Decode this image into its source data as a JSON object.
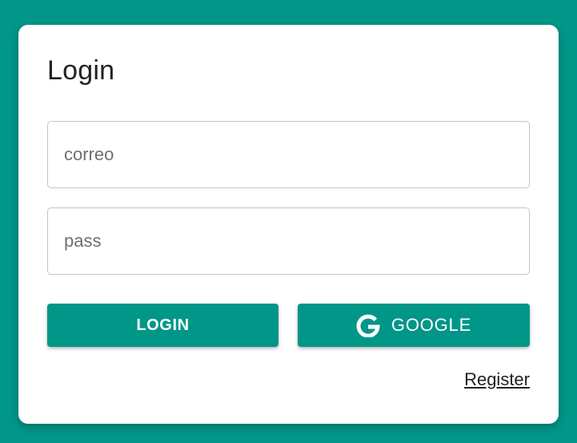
{
  "colors": {
    "background": "#009688",
    "card": "#ffffff",
    "button": "#009688",
    "button_text": "#ffffff"
  },
  "login_card": {
    "title": "Login",
    "email_field": {
      "placeholder": "correo",
      "value": ""
    },
    "password_field": {
      "placeholder": "pass",
      "value": ""
    },
    "login_button": {
      "label": "LOGIN"
    },
    "google_button": {
      "label": "GOOGLE",
      "icon": "google-icon"
    },
    "register_link": {
      "label": "Register"
    }
  }
}
